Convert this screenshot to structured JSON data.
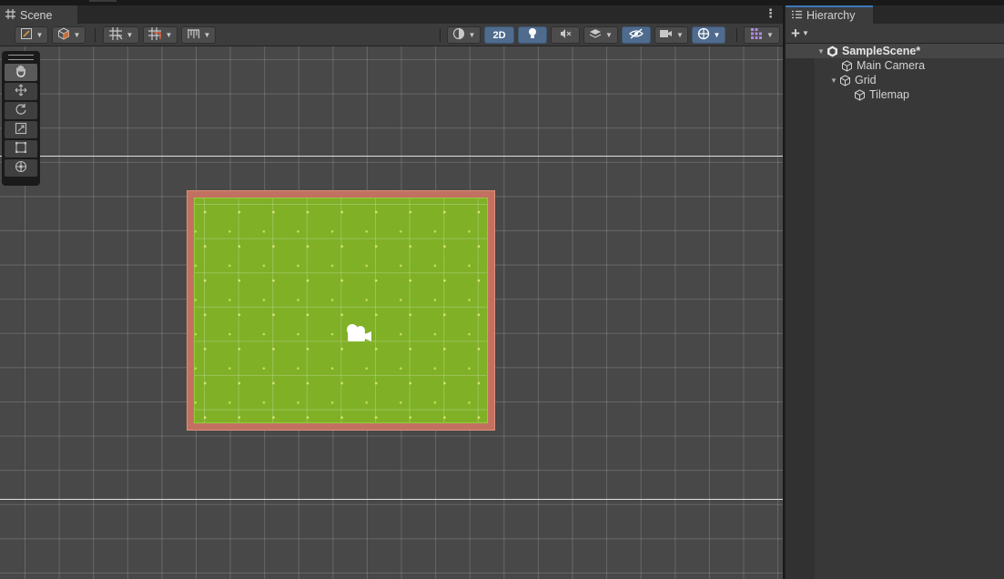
{
  "scene": {
    "tab_label": "Scene",
    "tab_icon": "grid-icon",
    "menu_icon": "kebab-icon",
    "toolbar": {
      "view_2d_label": "2D"
    }
  },
  "hierarchy": {
    "tab_label": "Hierarchy",
    "tab_icon": "list-icon",
    "add_label": "+",
    "items": [
      {
        "label": "SampleScene*",
        "type": "scene",
        "expanded": true
      },
      {
        "label": "Main Camera",
        "type": "gameobject"
      },
      {
        "label": "Grid",
        "type": "gameobject",
        "expanded": true
      },
      {
        "label": "Tilemap",
        "type": "gameobject"
      }
    ]
  },
  "colors": {
    "accent": "#3a79bb",
    "toggle_active": "#4f6b8e",
    "grass": "#7fb026",
    "tile_border": "#c27161"
  }
}
